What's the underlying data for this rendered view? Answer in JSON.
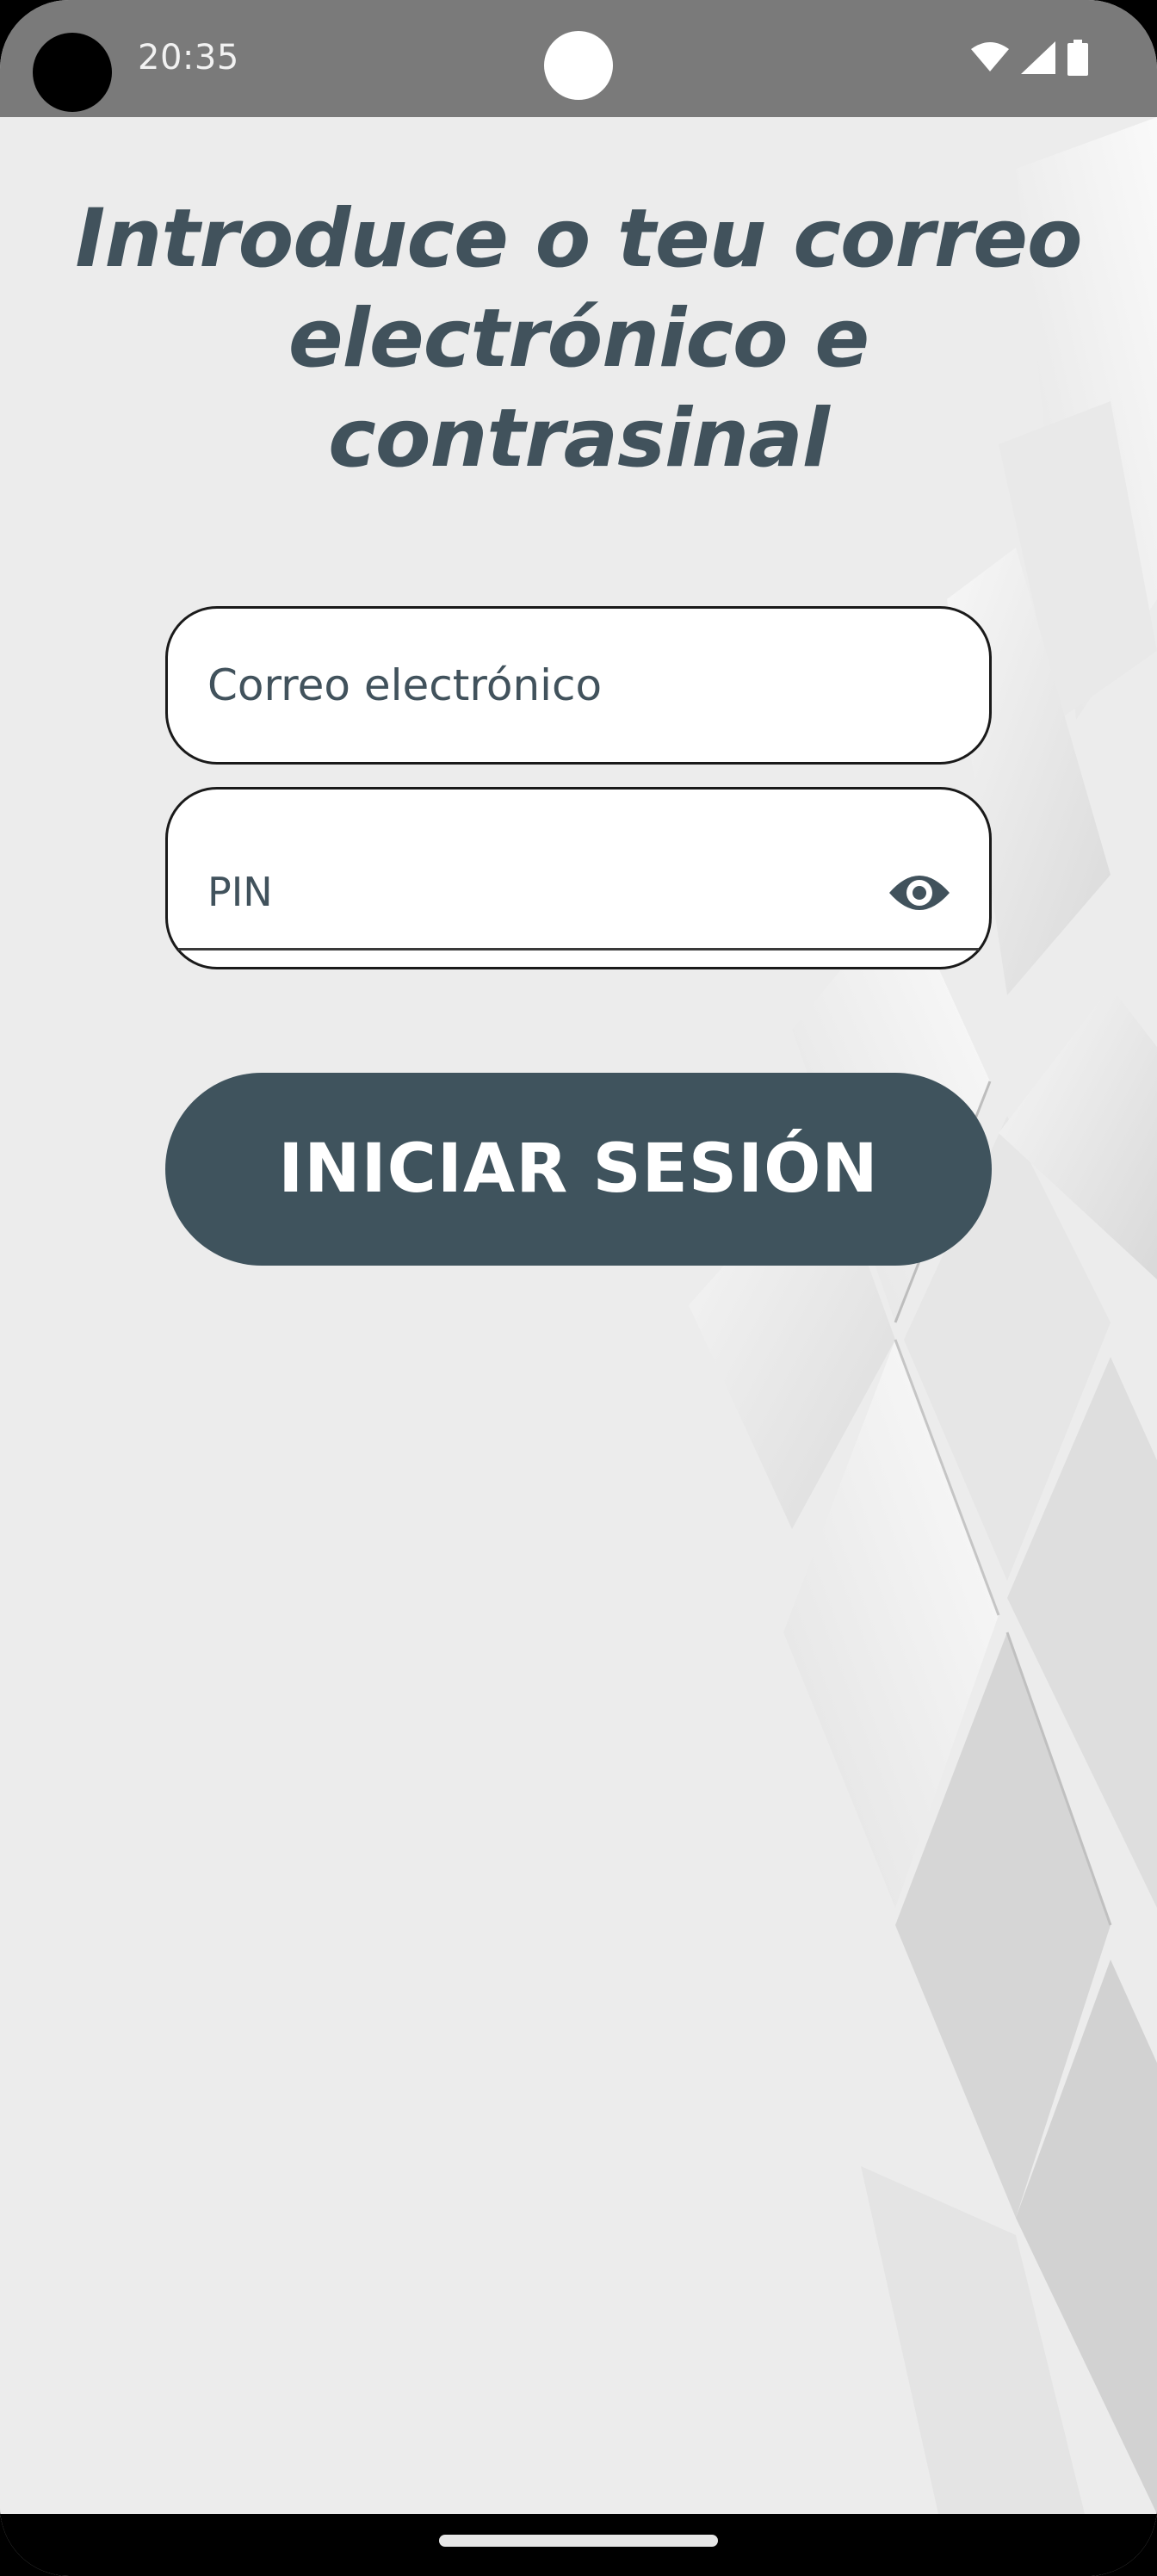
{
  "status_bar": {
    "time": "20:35",
    "icons": [
      "wifi-icon",
      "signal-icon",
      "battery-icon"
    ]
  },
  "login": {
    "title_line1": "Introduce o teu correo",
    "title_line2": "electrónico e contrasinal",
    "email_label": "Correo electrónico",
    "pin_label": "PIN",
    "submit_label": "INICIAR SESIÓN"
  },
  "colors": {
    "accent": "#3f535d",
    "title_text": "#41525c",
    "background": "#ececec",
    "status_bar": "#7a7a7a"
  }
}
